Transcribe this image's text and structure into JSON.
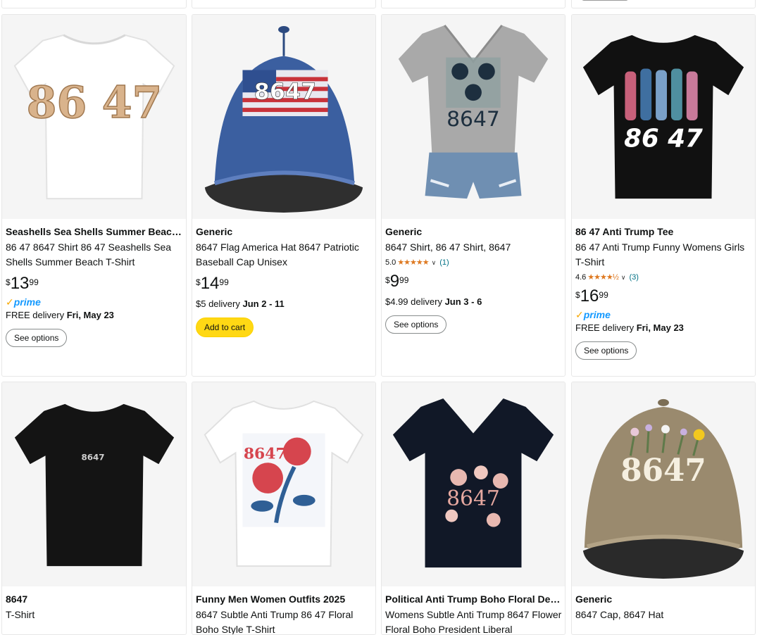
{
  "products": [
    {
      "brand": "Seashells Sea Shells Summer Beach Tees",
      "title": "86 47 8647 Shirt 86 47 Seashells Sea Shells Summer Beach T-Shirt",
      "price": {
        "currency": "$",
        "whole": "13",
        "fraction": "99"
      },
      "prime": "prime",
      "delivery_prefix": "FREE delivery",
      "delivery_date": "Fri, May 23",
      "button": "See options",
      "image_text": "86 47"
    },
    {
      "brand": "Generic",
      "title": "8647 Flag America Hat 8647 Patriotic Baseball Cap Unisex",
      "price": {
        "currency": "$",
        "whole": "14",
        "fraction": "99"
      },
      "delivery_prefix": "$5 delivery",
      "delivery_date": "Jun 2 - 11",
      "button": "Add to cart",
      "image_text": "8647"
    },
    {
      "brand": "Generic",
      "title": "8647 Shirt, 86 47 Shirt, 8647",
      "rating": {
        "value": "5.0",
        "count": "(1)",
        "stars": "★★★★★"
      },
      "price": {
        "currency": "$",
        "whole": "9",
        "fraction": "99"
      },
      "delivery_prefix": "$4.99 delivery",
      "delivery_date": "Jun 3 - 6",
      "button": "See options",
      "image_text": "8647"
    },
    {
      "brand": "86 47 Anti Trump Tee",
      "title": "86 47 Anti Trump Funny Womens Girls T-Shirt",
      "rating": {
        "value": "4.6",
        "count": "(3)",
        "stars": "★★★★½"
      },
      "price": {
        "currency": "$",
        "whole": "16",
        "fraction": "99"
      },
      "prime": "prime",
      "delivery_prefix": "FREE delivery",
      "delivery_date": "Fri, May 23",
      "button": "See options",
      "image_text": "86 47"
    },
    {
      "brand": "8647",
      "title": "T-Shirt",
      "image_text": "8647"
    },
    {
      "brand": "Funny Men Women Outfits 2025",
      "title": "8647 Subtle Anti Trump 86 47 Floral Boho Style T-Shirt",
      "image_text": "8647"
    },
    {
      "brand": "Political Anti Trump Boho Floral Designs",
      "title": "Womens Subtle Anti Trump 8647 Flower Floral Boho President Liberal",
      "image_text": "8647"
    },
    {
      "brand": "Generic",
      "title": "8647 Cap, 8647 Hat",
      "image_text": "8647"
    }
  ]
}
